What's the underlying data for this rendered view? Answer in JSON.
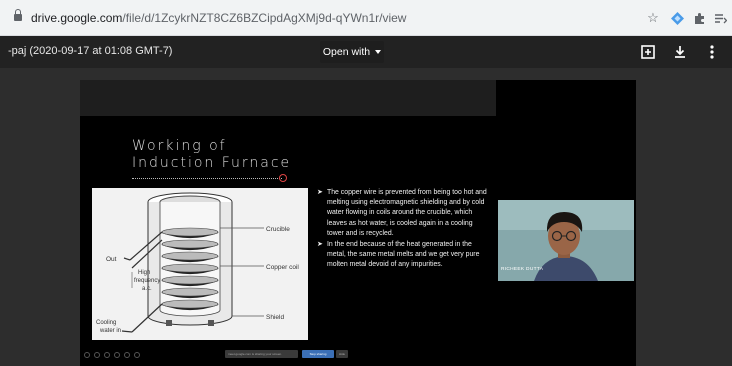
{
  "browser": {
    "url_host": "drive.google.com",
    "url_path": "/file/d/1ZcykrNZT8CZ6BZCipdAgXMj9d-qYWn1r/view",
    "icons": [
      "lock-icon",
      "star-icon",
      "extension-diamond-icon",
      "puzzle-icon",
      "reading-list-icon"
    ]
  },
  "viewer": {
    "file_title": "-paj (2020-09-17 at 01:08 GMT-7)",
    "open_with_label": "Open with",
    "icons": [
      "add-to-drive-icon",
      "download-icon",
      "more-vert-icon"
    ]
  },
  "slide": {
    "title_line1": "Working of",
    "title_line2": "Induction Furnace",
    "bullets": [
      "The copper wire is prevented from being too hot and melting using electromagnetic shielding and by cold water flowing in coils around the crucible, which leaves as hot water, is cooled again in a cooling tower and is recycled.",
      "In the end because of the heat generated in the metal, the same metal melts and we get very pure molten metal devoid of any impurities."
    ],
    "diagram_labels": {
      "crucible": "Crucible",
      "copper_coil": "Copper coil",
      "shield": "Shield",
      "out": "Out",
      "high_frequency": "High",
      "high_frequency_2": "frequency",
      "high_frequency_3": "a.c.",
      "cooling": "Cooling",
      "water_in": "water in"
    },
    "share_note": "meet.google.com is sharing your screen.",
    "stop_sharing": "Stop sharing",
    "hide": "Hide"
  },
  "webcam": {
    "participant_name": "RICHEEK DUTTA"
  }
}
